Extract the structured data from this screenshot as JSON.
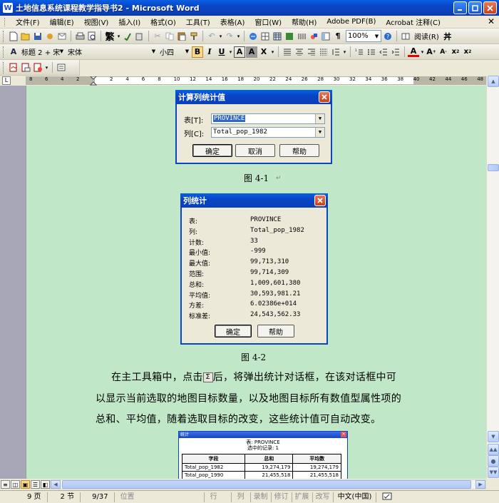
{
  "window": {
    "title": "土地信息系统课程教学指导书2 - Microsoft Word",
    "app_icon": "W"
  },
  "menu": [
    "文件(F)",
    "编辑(E)",
    "视图(V)",
    "插入(I)",
    "格式(O)",
    "工具(T)",
    "表格(A)",
    "窗口(W)",
    "帮助(H)",
    "Adobe PDF(B)",
    "Acrobat 注释(C)"
  ],
  "toolbar": {
    "zoom": "100%",
    "reading": "阅读(R)",
    "style": "标题 2 + 宋",
    "font": "宋体",
    "size": "小四",
    "traditional": "繁"
  },
  "ruler": {
    "numbers_left": [
      "8",
      "6",
      "4",
      "2"
    ],
    "numbers_right": [
      "2",
      "4",
      "6",
      "8",
      "10",
      "12",
      "14",
      "16",
      "18",
      "20",
      "22",
      "24",
      "26",
      "28",
      "30",
      "32",
      "34",
      "36",
      "38",
      "40",
      "42",
      "44",
      "46",
      "48"
    ]
  },
  "dialog1": {
    "title": "计算列统计值",
    "table_label": "表[T]:",
    "table_value": "PROVINCE",
    "column_label": "列[C]:",
    "column_value": "Total_pop_1982",
    "ok": "确定",
    "cancel": "取消",
    "help": "帮助"
  },
  "caption1": "图 4-1",
  "dialog2": {
    "title": "列统计",
    "rows": [
      {
        "k": "表:",
        "v": "PROVINCE"
      },
      {
        "k": "列:",
        "v": "Total_pop_1982"
      },
      {
        "k": "计数:",
        "v": "33"
      },
      {
        "k": "最小值:",
        "v": "-999"
      },
      {
        "k": "最大值:",
        "v": "99,713,310"
      },
      {
        "k": "范围:",
        "v": "99,714,309"
      },
      {
        "k": "总和:",
        "v": "1,009,601,380"
      },
      {
        "k": "平均值:",
        "v": "30,593,981.21"
      },
      {
        "k": "方差:",
        "v": "6.02386e+014"
      },
      {
        "k": "标准差:",
        "v": "24,543,562.33"
      }
    ],
    "ok": "确定",
    "help": "帮助"
  },
  "caption2": "图 4-2",
  "paragraph": {
    "line1_a": "在主工具箱中，点击",
    "sigma": "Σ",
    "line1_b": "后，将弹出统计对话框，在该对话框中可",
    "line2": "以显示当前选取的地图目标数量，以及地图目标所有数值型属性项的",
    "line3": "总和、平均值，随着选取目标的改变，这些统计值可自动改变。"
  },
  "table_dialog": {
    "title": "统计",
    "header1": "表: PROVINCE",
    "header2": "选中的记录: 1",
    "columns": [
      "字段",
      "总和",
      "平均数"
    ],
    "rows": [
      [
        "Total_pop_1982",
        "19,274,179",
        "19,274,179"
      ],
      [
        "Total_pop_1990",
        "21,455,518",
        "21,455,518"
      ]
    ]
  },
  "status": {
    "page": "9 页",
    "section": "2 节",
    "pages": "9/37",
    "position": "位置",
    "line": "行",
    "column": "列",
    "rec": "录制",
    "trk": "修订",
    "ext": "扩展",
    "ovr": "改写",
    "language": "中文(中国)"
  }
}
